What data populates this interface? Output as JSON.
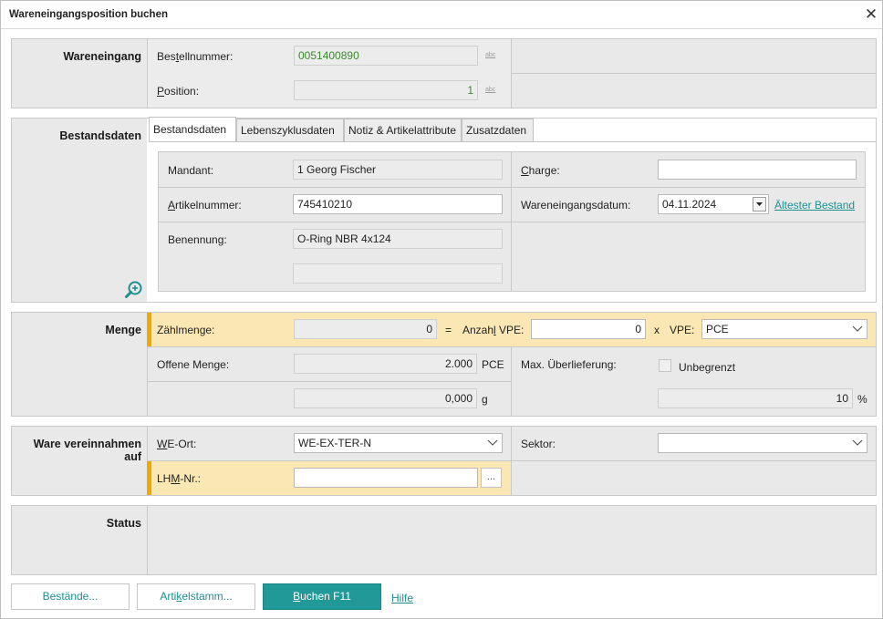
{
  "window": {
    "title": "Wareneingangsposition buchen",
    "close_glyph": "✕"
  },
  "wareneingang": {
    "section_label": "Wareneingang",
    "bestellnummer_label_pre": "Bes",
    "bestellnummer_label_u": "t",
    "bestellnummer_label_post": "ellnummer:",
    "bestellnummer_value": "0051400890",
    "position_label_pre": "",
    "position_label_u": "P",
    "position_label_post": "osition:",
    "position_value": "1",
    "abc_glyph": "abc"
  },
  "bestandsdaten": {
    "section_label": "Bestandsdaten",
    "tabs": [
      {
        "label": "Bestandsdaten"
      },
      {
        "label": "Lebenszyklusdaten"
      },
      {
        "label": "Notiz & Artikelattribute"
      },
      {
        "label": "Zusatzdaten"
      }
    ],
    "mandant_label": "Mandant:",
    "mandant_value": "1  Georg Fischer",
    "charge_label_pre": "",
    "charge_label_u": "C",
    "charge_label_post": "harge:",
    "charge_value": "",
    "artikelnummer_label_pre": "",
    "artikelnummer_label_u": "A",
    "artikelnummer_label_post": "rtikelnummer:",
    "artikelnummer_value": "745410210",
    "we_datum_label": "Wareneingangsdatum:",
    "we_datum_value": "04.11.2024",
    "aeltester_bestand_link": "Ältester Bestand",
    "benennung_label": "Benennung:",
    "benennung_value": "O-Ring NBR 4x124",
    "benennung2_value": ""
  },
  "menge": {
    "section_label": "Menge",
    "zaehlmenge_label": "Zählmenge:",
    "zaehlmenge_value": "0",
    "equals": "=",
    "anzahl_vpe_label_pre": "Anzah",
    "anzahl_vpe_label_u": "l",
    "anzahl_vpe_label_post": " VPE:",
    "anzahl_vpe_value": "0",
    "times": "x",
    "vpe_label": "VPE:",
    "vpe_value": "PCE",
    "offene_menge_label": "Offene Menge:",
    "offene_menge_value": "2.000",
    "offene_menge_unit": "PCE",
    "gewicht_value": "0,000",
    "gewicht_unit": "g",
    "max_ueberlieferung_label": "Max. Überlieferung:",
    "unbegrenzt_label": "Unbegrenzt",
    "unbegrenzt_checked": false,
    "ueberlieferung_value": "10",
    "ueberlieferung_unit": "%"
  },
  "ware_vereinnahmen": {
    "section_label_line1": "Ware vereinnahmen",
    "section_label_line2": "auf",
    "we_ort_label_pre": "",
    "we_ort_label_u": "W",
    "we_ort_label_post": "E-Ort:",
    "we_ort_value": "WE-EX-TER-N",
    "sektor_label": "Sektor:",
    "sektor_value": "",
    "lhm_label_pre": "LH",
    "lhm_label_u": "M",
    "lhm_label_post": "-Nr.:",
    "lhm_value": "",
    "lhm_button": "..."
  },
  "status": {
    "section_label": "Status"
  },
  "footer": {
    "bestaende_button": "Bestände...",
    "artikelstamm_pre": "Arti",
    "artikelstamm_u": "k",
    "artikelstamm_post": "elstamm...",
    "buchen_pre": "",
    "buchen_u": "B",
    "buchen_post": "uchen F11",
    "hilfe_link": "Hilfe"
  },
  "colors": {
    "accent": "#219999",
    "highlight": "#fbe7b3",
    "highlight_bar": "#f0a800",
    "panel": "#e9e9e9"
  },
  "icons": {
    "zoom": "zoom-in-icon",
    "dropdown": "chevron-down-icon",
    "calendar_dropdown": "dropdown-arrow-icon"
  }
}
